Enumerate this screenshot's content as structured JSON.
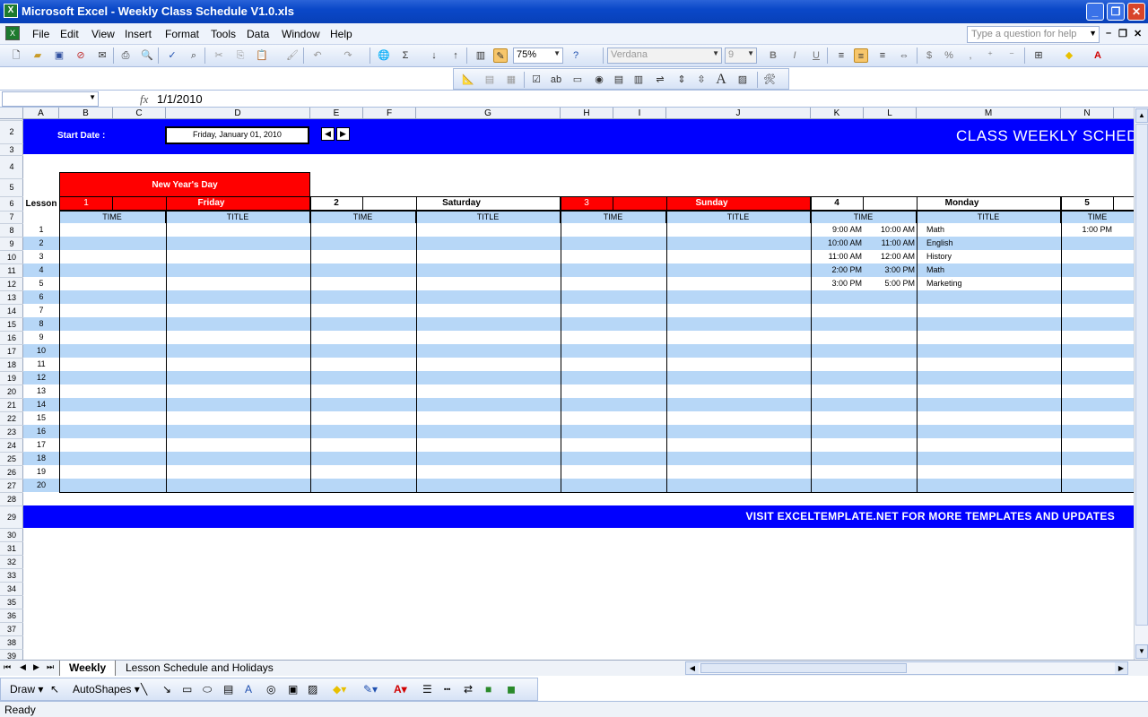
{
  "window": {
    "title": "Microsoft Excel - Weekly Class Schedule V1.0.xls",
    "app_icon": "excel-icon",
    "controls": [
      "minimize",
      "restore",
      "close"
    ]
  },
  "menu": {
    "items": [
      "File",
      "Edit",
      "View",
      "Insert",
      "Format",
      "Tools",
      "Data",
      "Window",
      "Help"
    ],
    "help_placeholder": "Type a question for help"
  },
  "toolbar": {
    "zoom": "75%",
    "font": "Verdana",
    "font_size": "9"
  },
  "formula_bar": {
    "name_box": "",
    "fx": "fx",
    "value": "1/1/2010"
  },
  "columns": [
    "A",
    "B",
    "C",
    "D",
    "E",
    "F",
    "G",
    "H",
    "I",
    "J",
    "K",
    "L",
    "M",
    "N"
  ],
  "rows": [
    "1",
    "2",
    "3",
    "4",
    "5",
    "6",
    "7",
    "8",
    "9",
    "10",
    "11",
    "12",
    "13",
    "14",
    "15",
    "16",
    "17",
    "18",
    "19",
    "20",
    "21",
    "22",
    "23",
    "24",
    "25",
    "26",
    "27",
    "28",
    "29",
    "30",
    "31",
    "32",
    "33",
    "34",
    "35",
    "36",
    "37",
    "38",
    "39"
  ],
  "sheet": {
    "start_date_label": "Start Date :",
    "start_date_value": "Friday, January 01, 2010",
    "prev_label": "◀",
    "next_label": "▶",
    "schedule_title": "CLASS WEEKLY SCHEDULE",
    "holiday": "New Year's Day",
    "lesson_header": "Lesson",
    "days": [
      {
        "num": "1",
        "name": "Friday",
        "holiday": true
      },
      {
        "num": "2",
        "name": "Saturday",
        "holiday": false
      },
      {
        "num": "3",
        "name": "Sunday",
        "holiday": true
      },
      {
        "num": "4",
        "name": "Monday",
        "holiday": false
      },
      {
        "num": "5",
        "name": "",
        "holiday": false
      }
    ],
    "time_header": "TIME",
    "title_header": "TITLE",
    "lessons": [
      "1",
      "2",
      "3",
      "4",
      "5",
      "6",
      "7",
      "8",
      "9",
      "10",
      "11",
      "12",
      "13",
      "14",
      "15",
      "16",
      "17",
      "18",
      "19",
      "20"
    ],
    "monday_entries": [
      {
        "start": "9:00 AM",
        "end": "10:00 AM",
        "title": "Math"
      },
      {
        "start": "10:00 AM",
        "end": "11:00 AM",
        "title": "English"
      },
      {
        "start": "11:00 AM",
        "end": "12:00 AM",
        "title": "History"
      },
      {
        "start": "2:00 PM",
        "end": "3:00 PM",
        "title": "Math"
      },
      {
        "start": "3:00 PM",
        "end": "5:00 PM",
        "title": "Marketing"
      }
    ],
    "day5_first_time": "1:00 PM",
    "footer": "VISIT EXCELTEMPLATE.NET FOR MORE TEMPLATES AND UPDATES"
  },
  "tabs": [
    "Weekly",
    "Lesson Schedule and Holidays"
  ],
  "draw_toolbar": {
    "draw": "Draw",
    "autoshapes": "AutoShapes"
  },
  "status": "Ready",
  "colors": {
    "band_blue": "#0000ff",
    "holiday_red": "#ff0000",
    "stripe_blue": "#b7d7f7"
  }
}
